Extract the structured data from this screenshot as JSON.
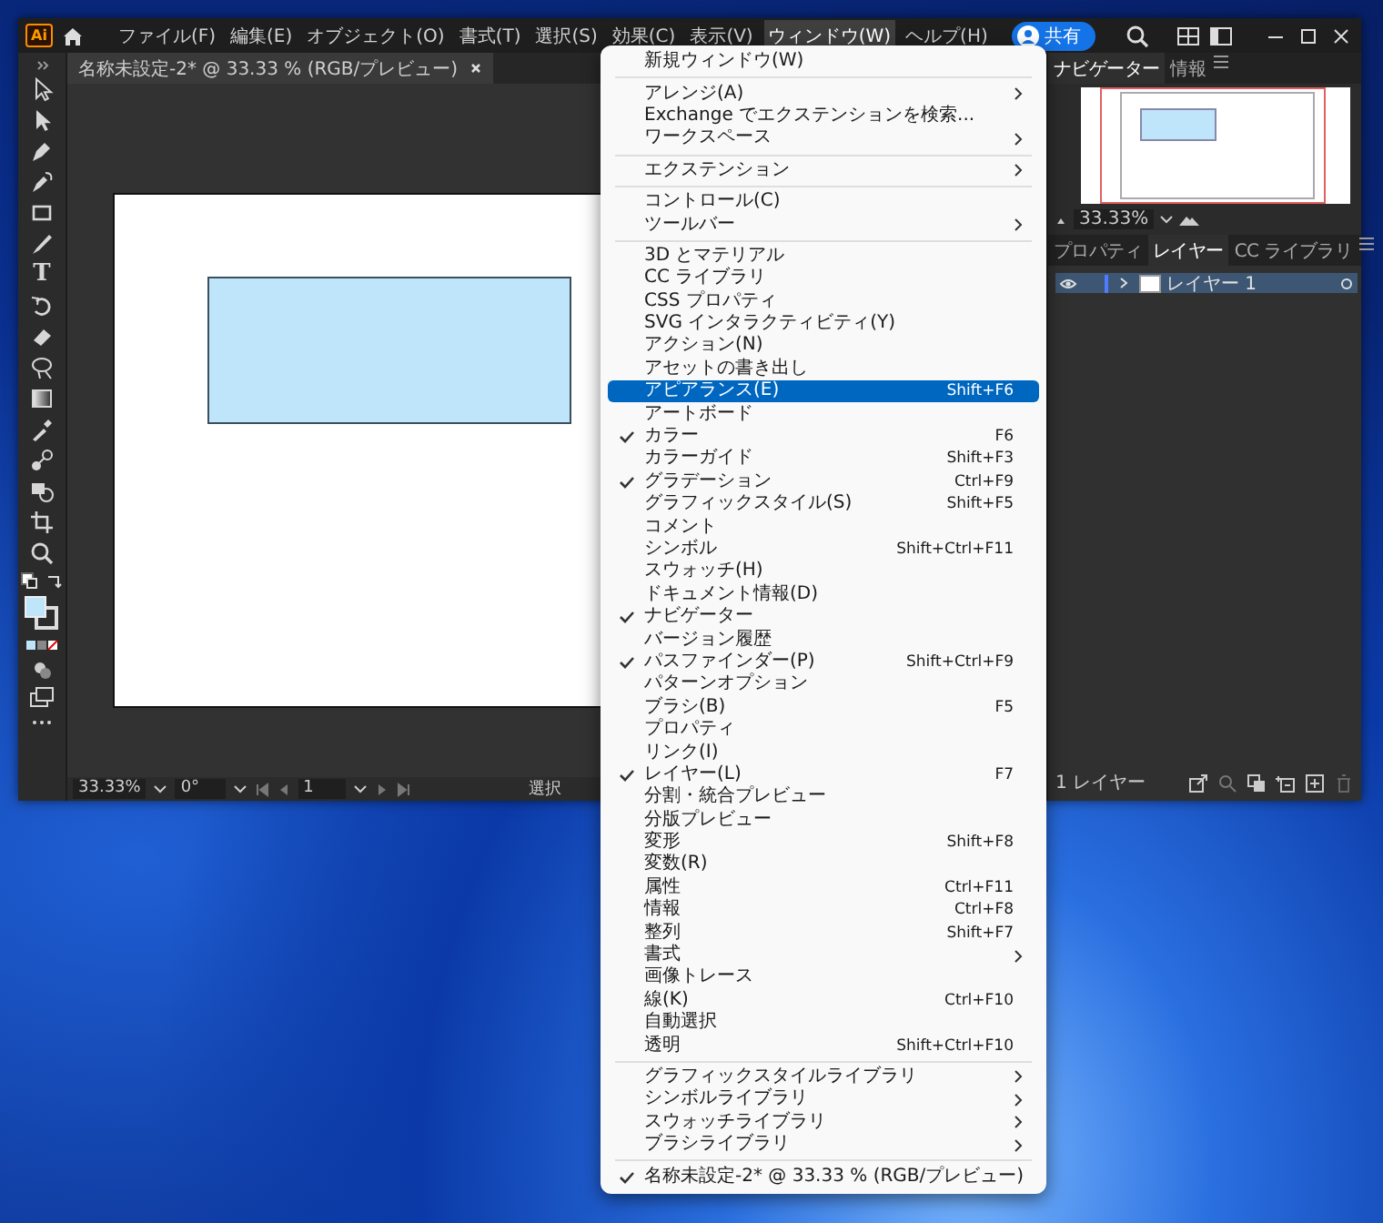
{
  "app": {
    "logo": "Ai"
  },
  "menu_bar": [
    {
      "label": "ファイル(F)",
      "selected": false
    },
    {
      "label": "編集(E)",
      "selected": false
    },
    {
      "label": "オブジェクト(O)",
      "selected": false
    },
    {
      "label": "書式(T)",
      "selected": false
    },
    {
      "label": "選択(S)",
      "selected": false
    },
    {
      "label": "効果(C)",
      "selected": false
    },
    {
      "label": "表示(V)",
      "selected": false
    },
    {
      "label": "ウィンドウ(W)",
      "selected": true
    },
    {
      "label": "ヘルプ(H)",
      "selected": false
    }
  ],
  "share_button": "共有",
  "document_tab": {
    "title": "名称未設定-2* @ 33.33 % (RGB/プレビュー)"
  },
  "toolbar": {
    "type_glyph": "T"
  },
  "status_bar": {
    "zoom": "33.33%",
    "rotation": "0°",
    "page": "1",
    "tool": "選択"
  },
  "navigator_panel": {
    "tabs": [
      {
        "label": "ナビゲーター",
        "selected": true
      },
      {
        "label": "情報",
        "selected": false
      }
    ],
    "zoom": "33.33%"
  },
  "layers_panel": {
    "tabs": [
      {
        "label": "プロパティ",
        "selected": false
      },
      {
        "label": "レイヤー",
        "selected": true
      },
      {
        "label": "CC ライブラリ",
        "selected": false
      }
    ],
    "layers": [
      {
        "name": "レイヤー 1",
        "visible": true,
        "expanded": false,
        "selected": true
      }
    ],
    "count": "1 レイヤー"
  },
  "window_menu": {
    "items": [
      {
        "kind": "item",
        "label": "新規ウィンドウ(W)",
        "checked": false,
        "submenu": false,
        "selected": false
      },
      {
        "kind": "separator"
      },
      {
        "kind": "item",
        "label": "アレンジ(A)",
        "checked": false,
        "submenu": true,
        "selected": false
      },
      {
        "kind": "item",
        "label": "Exchange でエクステンションを検索...",
        "checked": false,
        "submenu": false,
        "selected": false
      },
      {
        "kind": "item",
        "label": "ワークスペース",
        "checked": false,
        "submenu": true,
        "selected": false
      },
      {
        "kind": "separator"
      },
      {
        "kind": "item",
        "label": "エクステンション",
        "checked": false,
        "submenu": true,
        "selected": false
      },
      {
        "kind": "separator"
      },
      {
        "kind": "item",
        "label": "コントロール(C)",
        "checked": false,
        "submenu": false,
        "selected": false
      },
      {
        "kind": "item",
        "label": "ツールバー",
        "checked": false,
        "submenu": true,
        "selected": false
      },
      {
        "kind": "separator"
      },
      {
        "kind": "item",
        "label": "3D とマテリアル",
        "checked": false,
        "submenu": false,
        "selected": false
      },
      {
        "kind": "item",
        "label": "CC ライブラリ",
        "checked": false,
        "submenu": false,
        "selected": false
      },
      {
        "kind": "item",
        "label": "CSS プロパティ",
        "checked": false,
        "submenu": false,
        "selected": false
      },
      {
        "kind": "item",
        "label": "SVG インタラクティビティ(Y)",
        "checked": false,
        "submenu": false,
        "selected": false
      },
      {
        "kind": "item",
        "label": "アクション(N)",
        "checked": false,
        "submenu": false,
        "selected": false
      },
      {
        "kind": "item",
        "label": "アセットの書き出し",
        "checked": false,
        "submenu": false,
        "selected": false
      },
      {
        "kind": "item",
        "label": "アピアランス(E)",
        "shortcut": "Shift+F6",
        "checked": false,
        "submenu": false,
        "selected": true
      },
      {
        "kind": "item",
        "label": "アートボード",
        "checked": false,
        "submenu": false,
        "selected": false
      },
      {
        "kind": "item",
        "label": "カラー",
        "shortcut": "F6",
        "checked": true,
        "submenu": false,
        "selected": false
      },
      {
        "kind": "item",
        "label": "カラーガイド",
        "shortcut": "Shift+F3",
        "checked": false,
        "submenu": false,
        "selected": false
      },
      {
        "kind": "item",
        "label": "グラデーション",
        "shortcut": "Ctrl+F9",
        "checked": true,
        "submenu": false,
        "selected": false
      },
      {
        "kind": "item",
        "label": "グラフィックスタイル(S)",
        "shortcut": "Shift+F5",
        "checked": false,
        "submenu": false,
        "selected": false
      },
      {
        "kind": "item",
        "label": "コメント",
        "checked": false,
        "submenu": false,
        "selected": false
      },
      {
        "kind": "item",
        "label": "シンボル",
        "shortcut": "Shift+Ctrl+F11",
        "checked": false,
        "submenu": false,
        "selected": false
      },
      {
        "kind": "item",
        "label": "スウォッチ(H)",
        "checked": false,
        "submenu": false,
        "selected": false
      },
      {
        "kind": "item",
        "label": "ドキュメント情報(D)",
        "checked": false,
        "submenu": false,
        "selected": false
      },
      {
        "kind": "item",
        "label": "ナビゲーター",
        "checked": true,
        "submenu": false,
        "selected": false
      },
      {
        "kind": "item",
        "label": "バージョン履歴",
        "checked": false,
        "submenu": false,
        "selected": false
      },
      {
        "kind": "item",
        "label": "パスファインダー(P)",
        "shortcut": "Shift+Ctrl+F9",
        "checked": true,
        "submenu": false,
        "selected": false
      },
      {
        "kind": "item",
        "label": "パターンオプション",
        "checked": false,
        "submenu": false,
        "selected": false
      },
      {
        "kind": "item",
        "label": "ブラシ(B)",
        "shortcut": "F5",
        "checked": false,
        "submenu": false,
        "selected": false
      },
      {
        "kind": "item",
        "label": "プロパティ",
        "checked": false,
        "submenu": false,
        "selected": false
      },
      {
        "kind": "item",
        "label": "リンク(I)",
        "checked": false,
        "submenu": false,
        "selected": false
      },
      {
        "kind": "item",
        "label": "レイヤー(L)",
        "shortcut": "F7",
        "checked": true,
        "submenu": false,
        "selected": false
      },
      {
        "kind": "item",
        "label": "分割・統合プレビュー",
        "checked": false,
        "submenu": false,
        "selected": false
      },
      {
        "kind": "item",
        "label": "分版プレビュー",
        "checked": false,
        "submenu": false,
        "selected": false
      },
      {
        "kind": "item",
        "label": "変形",
        "shortcut": "Shift+F8",
        "checked": false,
        "submenu": false,
        "selected": false
      },
      {
        "kind": "item",
        "label": "変数(R)",
        "checked": false,
        "submenu": false,
        "selected": false
      },
      {
        "kind": "item",
        "label": "属性",
        "shortcut": "Ctrl+F11",
        "checked": false,
        "submenu": false,
        "selected": false
      },
      {
        "kind": "item",
        "label": "情報",
        "shortcut": "Ctrl+F8",
        "checked": false,
        "submenu": false,
        "selected": false
      },
      {
        "kind": "item",
        "label": "整列",
        "shortcut": "Shift+F7",
        "checked": false,
        "submenu": false,
        "selected": false
      },
      {
        "kind": "item",
        "label": "書式",
        "checked": false,
        "submenu": true,
        "selected": false
      },
      {
        "kind": "item",
        "label": "画像トレース",
        "checked": false,
        "submenu": false,
        "selected": false
      },
      {
        "kind": "item",
        "label": "線(K)",
        "shortcut": "Ctrl+F10",
        "checked": false,
        "submenu": false,
        "selected": false
      },
      {
        "kind": "item",
        "label": "自動選択",
        "checked": false,
        "submenu": false,
        "selected": false
      },
      {
        "kind": "item",
        "label": "透明",
        "shortcut": "Shift+Ctrl+F10",
        "checked": false,
        "submenu": false,
        "selected": false
      },
      {
        "kind": "separator"
      },
      {
        "kind": "item",
        "label": "グラフィックスタイルライブラリ",
        "checked": false,
        "submenu": true,
        "selected": false
      },
      {
        "kind": "item",
        "label": "シンボルライブラリ",
        "checked": false,
        "submenu": true,
        "selected": false
      },
      {
        "kind": "item",
        "label": "スウォッチライブラリ",
        "checked": false,
        "submenu": true,
        "selected": false
      },
      {
        "kind": "item",
        "label": "ブラシライブラリ",
        "checked": false,
        "submenu": true,
        "selected": false
      },
      {
        "kind": "separator"
      },
      {
        "kind": "item",
        "label": "名称未設定-2* @ 33.33 % (RGB/プレビュー)",
        "checked": true,
        "submenu": false,
        "selected": false
      }
    ]
  }
}
